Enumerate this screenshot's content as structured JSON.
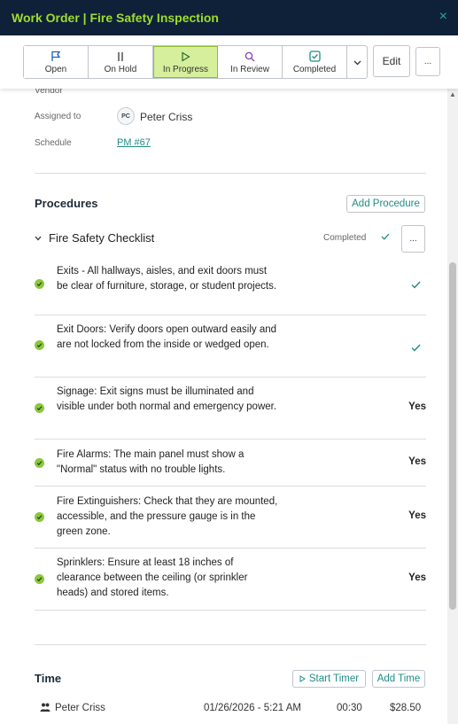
{
  "header": {
    "title": "Work Order | Fire Safety Inspection",
    "close_glyph": "×"
  },
  "toolbar": {
    "statuses": [
      {
        "label": "Open",
        "icon": "flag-icon"
      },
      {
        "label": "On Hold",
        "icon": "pause-icon"
      },
      {
        "label": "In Progress",
        "icon": "play-icon",
        "active": true
      },
      {
        "label": "In Review",
        "icon": "magnifier-icon"
      },
      {
        "label": "Completed",
        "icon": "check-square-icon"
      }
    ],
    "edit_label": "Edit",
    "more_label": "..."
  },
  "details": {
    "vendor_label": "Vendor",
    "assigned_label": "Assigned to",
    "assignee_initials": "PC",
    "assignee_name": "Peter Criss",
    "schedule_label": "Schedule",
    "schedule_link": "PM #67"
  },
  "procedures": {
    "title": "Procedures",
    "add_label": "Add Procedure",
    "checklist": {
      "name": "Fire Safety Checklist",
      "status": "Completed",
      "more_label": "..."
    },
    "items": [
      {
        "text": "Exits - All hallways, aisles, and exit doors must be clear of furniture, storage, or student projects.",
        "answer": "",
        "answer_type": "check"
      },
      {
        "text": "Exit Doors: Verify doors open outward easily and are not locked from the inside or wedged open.",
        "answer": "",
        "answer_type": "check"
      },
      {
        "text": "Signage: Exit signs must be illuminated and visible under both normal and emergency power.",
        "answer": "Yes",
        "answer_type": "text"
      },
      {
        "text": "Fire Alarms: The main panel must show a \"Normal\" status with no trouble lights.",
        "answer": "Yes",
        "answer_type": "text"
      },
      {
        "text": "Fire Extinguishers: Check that they are mounted, accessible, and the pressure gauge is in the green zone.",
        "answer": "Yes",
        "answer_type": "text"
      },
      {
        "text": "Sprinklers: Ensure at least 18 inches of clearance between the ceiling (or sprinkler heads) and stored items.",
        "answer": "Yes",
        "answer_type": "text"
      }
    ]
  },
  "time": {
    "title": "Time",
    "start_timer_label": "Start Timer",
    "add_time_label": "Add Time",
    "entries": [
      {
        "person": "Peter Criss",
        "datetime": "01/26/2026 - 5:21 AM",
        "duration": "00:30",
        "cost": "$28.50"
      }
    ]
  },
  "colors": {
    "header_bg": "#0e2138",
    "title_color": "#9fdc2d",
    "accent": "#1f8c86",
    "active_status_bg": "#d6ef9c",
    "item_dot": "#8cc63f"
  }
}
